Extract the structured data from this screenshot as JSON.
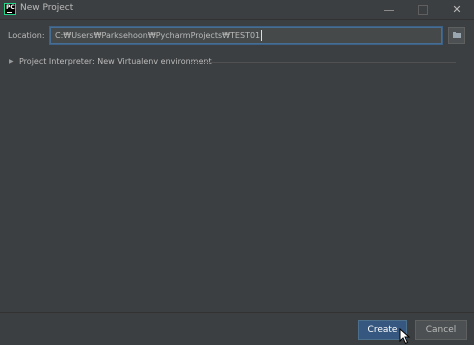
{
  "window": {
    "title": "New Project",
    "app_icon_letters": "PC",
    "close_glyph": "✕"
  },
  "location": {
    "label": "Location:",
    "value": "C:₩Users₩Parksehoon₩PycharmProjects₩TEST01"
  },
  "interpreter": {
    "label": "Project Interpreter: New Virtualenv environment",
    "expanded": false
  },
  "buttons": {
    "create": "Create",
    "cancel": "Cancel"
  },
  "colors": {
    "background": "#3c3f41",
    "accent": "#365880",
    "focus_border": "#466d94"
  }
}
